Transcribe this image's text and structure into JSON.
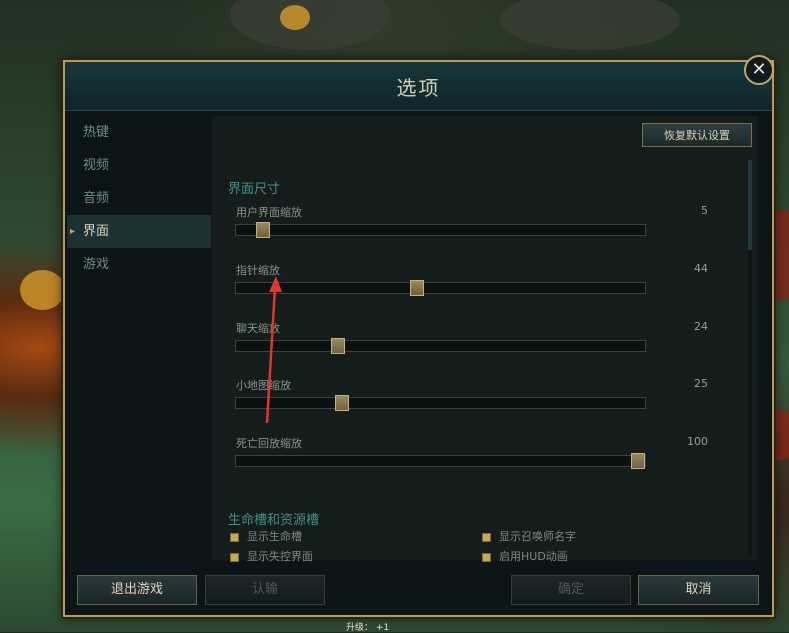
{
  "dialog": {
    "title": "选项",
    "close_label": "✕"
  },
  "sidebar": {
    "items": [
      {
        "label": "热键",
        "active": false
      },
      {
        "label": "视频",
        "active": false
      },
      {
        "label": "音频",
        "active": false
      },
      {
        "label": "界面",
        "active": true
      },
      {
        "label": "游戏",
        "active": false
      }
    ]
  },
  "content": {
    "restore_defaults_label": "恢复默认设置",
    "section_interface_size": "界面尺寸",
    "sliders": [
      {
        "label": "用户界面缩放",
        "value": 5,
        "max": 100
      },
      {
        "label": "指针缩放",
        "value": 44,
        "max": 100
      },
      {
        "label": "聊天缩放",
        "value": 24,
        "max": 100
      },
      {
        "label": "小地图缩放",
        "value": 25,
        "max": 100
      },
      {
        "label": "死亡回放缩放",
        "value": 100,
        "max": 100
      }
    ],
    "section_health_bars": "生命槽和资源槽",
    "checkboxes": [
      {
        "label": "显示生命槽",
        "checked": true
      },
      {
        "label": "显示召唤师名字",
        "checked": true
      },
      {
        "label": "显示失控界面",
        "checked": true
      },
      {
        "label": "启用HUD动画",
        "checked": true
      }
    ]
  },
  "footer": {
    "exit_game_label": "退出游戏",
    "surrender_label": "认输",
    "confirm_label": "确定",
    "cancel_label": "取消",
    "level_up_text": "升级：  +1"
  },
  "colors": {
    "accent_gold": "#b59a58",
    "section_teal": "#3f8f8c",
    "annotation_arrow": "#e0362c"
  }
}
